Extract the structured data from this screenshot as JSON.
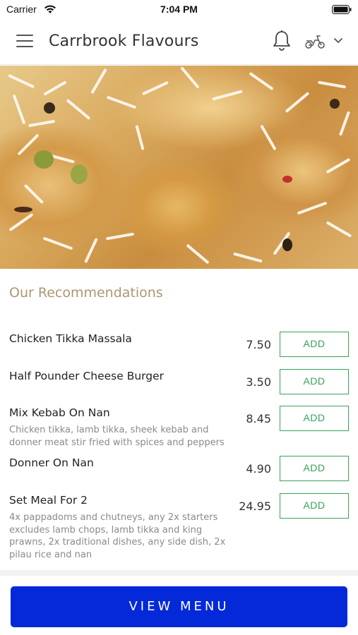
{
  "status_bar": {
    "carrier": "Carrier",
    "time": "7:04 PM",
    "wifi_icon": "wifi-icon",
    "battery_icon": "battery-icon"
  },
  "header": {
    "title": "Carrbrook Flavours",
    "menu_icon": "hamburger-menu-icon",
    "notification_icon": "bell-icon",
    "delivery_icon": "scooter-icon",
    "dropdown_icon": "chevron-down-icon"
  },
  "hero": {
    "image": "chicken biryani photo"
  },
  "recommendations": {
    "title": "Our Recommendations",
    "items": [
      {
        "name": "Chicken Tikka Massala",
        "description": "",
        "price": "7.50",
        "add_label": "ADD"
      },
      {
        "name": "Half Pounder Cheese Burger",
        "description": "",
        "price": "3.50",
        "add_label": "ADD"
      },
      {
        "name": "Mix Kebab On Nan",
        "description": "Chicken tikka, lamb tikka, sheek kebab and donner meat stir fried with spices and peppers",
        "price": "8.45",
        "add_label": "ADD"
      },
      {
        "name": "Donner On Nan",
        "description": "",
        "price": "4.90",
        "add_label": "ADD"
      },
      {
        "name": "Set Meal For 2",
        "description": "4x pappadoms and chutneys, any 2x starters excludes lamb chops, lamb tikka and king prawns, 2x traditional dishes, any side dish, 2x pilau rice and nan",
        "price": "24.95",
        "add_label": "ADD"
      }
    ]
  },
  "footer": {
    "view_menu_label": "VIEW MENU"
  },
  "colors": {
    "accent_button": "#0329d8",
    "add_green": "#3aa05a",
    "section_title": "#ad9674"
  }
}
